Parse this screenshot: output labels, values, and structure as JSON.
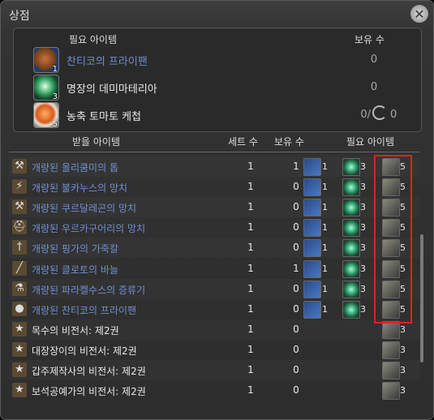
{
  "window": {
    "title": "상점",
    "close_symbol": "✕"
  },
  "required_panel": {
    "header_item": "필요 아이템",
    "header_have": "보유 수",
    "items": [
      {
        "name": "찬티코의 프라이팬",
        "qty": "1",
        "have": "0",
        "color": "#6f8fd0",
        "icon": "pan-icon"
      },
      {
        "name": "명장의 데미마테리아",
        "qty": "3",
        "have": "0",
        "color": "#e8e8e8",
        "icon": "demimateria-icon"
      },
      {
        "name": "농축 토마토 케첩",
        "qty": "5",
        "have": "0/",
        "have2": "0",
        "color": "#e8e8e8",
        "icon": "ketchup-icon"
      }
    ]
  },
  "list_header": {
    "item": "받을 아이템",
    "set": "세트 수",
    "have": "보유 수",
    "cost": "필요 아이템"
  },
  "rows": [
    {
      "icon": "hammer-icon",
      "name": "개량된 올리쿰미의 톱",
      "blue": true,
      "set": "1",
      "have": "1",
      "c1": "1",
      "c2": "3",
      "c3": "5"
    },
    {
      "icon": "bolt-icon",
      "name": "개량된 불카누스의 망치",
      "blue": true,
      "set": "1",
      "have": "0",
      "c1": "1",
      "c2": "3",
      "c3": "5"
    },
    {
      "icon": "anvil-icon",
      "name": "개량된 쿠르달레곤의 망치",
      "blue": true,
      "set": "1",
      "have": "0",
      "c1": "1",
      "c2": "3",
      "c3": "5"
    },
    {
      "icon": "helm-icon",
      "name": "개량된 우르카구어리의 망치",
      "blue": true,
      "set": "1",
      "have": "0",
      "c1": "1",
      "c2": "3",
      "c3": "5"
    },
    {
      "icon": "knife-icon",
      "name": "개량된 핑가의 가죽칼",
      "blue": true,
      "set": "1",
      "have": "0",
      "c1": "1",
      "c2": "3",
      "c3": "5"
    },
    {
      "icon": "needle-icon",
      "name": "개량된 클로토의 바늘",
      "blue": true,
      "set": "1",
      "have": "1",
      "c1": "1",
      "c2": "3",
      "c3": "5"
    },
    {
      "icon": "alembic-icon",
      "name": "개량된 파라켈수스의 증류기",
      "blue": true,
      "set": "1",
      "have": "0",
      "c1": "1",
      "c2": "3",
      "c3": "5"
    },
    {
      "icon": "pan-icon",
      "name": "개량된 찬티코의 프라이팬",
      "blue": true,
      "set": "1",
      "have": "0",
      "c1": "1",
      "c2": "3",
      "c3": "5"
    },
    {
      "icon": "book-icon",
      "name": "목수의 비전서: 제2권",
      "blue": false,
      "set": "1",
      "have": "0",
      "c1": "",
      "c2": "",
      "c3": "3"
    },
    {
      "icon": "book-icon",
      "name": "대장장이의 비전서: 제2권",
      "blue": false,
      "set": "1",
      "have": "0",
      "c1": "",
      "c2": "",
      "c3": "3"
    },
    {
      "icon": "book-icon",
      "name": "갑주제작사의 비전서: 제2권",
      "blue": false,
      "set": "1",
      "have": "0",
      "c1": "",
      "c2": "",
      "c3": "3"
    },
    {
      "icon": "book-icon",
      "name": "보석공예가의 비전서: 제2권",
      "blue": false,
      "set": "1",
      "have": "0",
      "c1": "",
      "c2": "",
      "c3": "3"
    }
  ]
}
